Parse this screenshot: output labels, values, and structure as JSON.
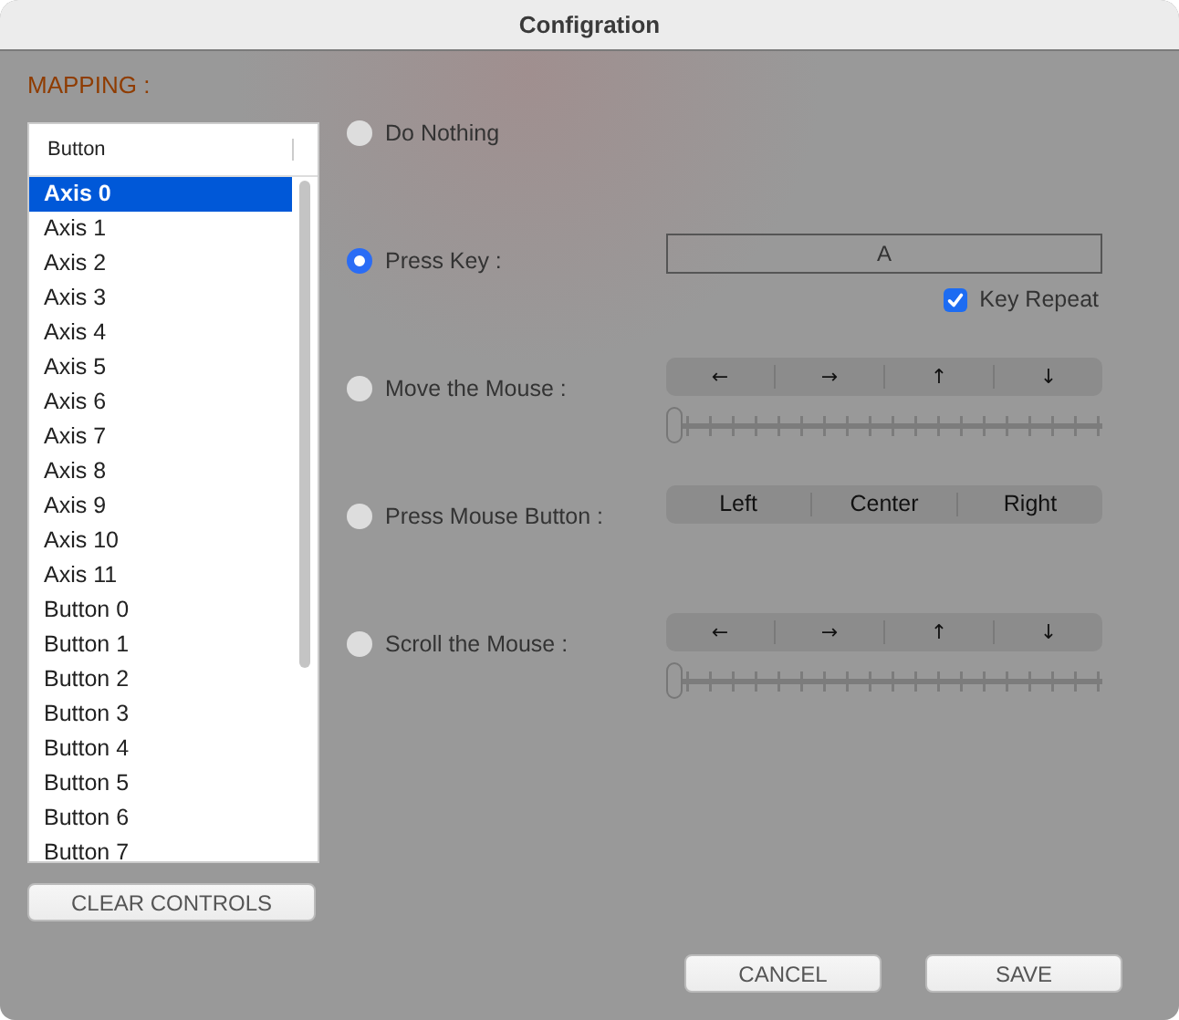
{
  "window": {
    "title": "Configration"
  },
  "mapping_label": "MAPPING :",
  "list": {
    "header": "Button",
    "items": [
      {
        "label": "Axis 0",
        "selected": true
      },
      {
        "label": "Axis 1",
        "selected": false
      },
      {
        "label": "Axis 2",
        "selected": false
      },
      {
        "label": "Axis 3",
        "selected": false
      },
      {
        "label": "Axis 4",
        "selected": false
      },
      {
        "label": "Axis 5",
        "selected": false
      },
      {
        "label": "Axis 6",
        "selected": false
      },
      {
        "label": "Axis 7",
        "selected": false
      },
      {
        "label": "Axis 8",
        "selected": false
      },
      {
        "label": "Axis 9",
        "selected": false
      },
      {
        "label": "Axis 10",
        "selected": false
      },
      {
        "label": "Axis 11",
        "selected": false
      },
      {
        "label": "Button 0",
        "selected": false
      },
      {
        "label": "Button 1",
        "selected": false
      },
      {
        "label": "Button 2",
        "selected": false
      },
      {
        "label": "Button 3",
        "selected": false
      },
      {
        "label": "Button 4",
        "selected": false
      },
      {
        "label": "Button 5",
        "selected": false
      },
      {
        "label": "Button 6",
        "selected": false
      },
      {
        "label": "Button 7",
        "selected": false
      }
    ]
  },
  "clear_button": "CLEAR CONTROLS",
  "options": [
    {
      "kind": "none",
      "label": "Do Nothing",
      "selected": false
    },
    {
      "kind": "key",
      "label": "Press Key :",
      "selected": true,
      "key_value": "A",
      "key_repeat": {
        "label": "Key Repeat",
        "checked": true
      }
    },
    {
      "kind": "arrows",
      "label": "Move the Mouse :",
      "selected": false,
      "arrows": [
        "←",
        "→",
        "↑",
        "↓"
      ],
      "level": 0
    },
    {
      "kind": "segments",
      "label": "Press Mouse Button :",
      "selected": false,
      "segments": [
        "Left",
        "Center",
        "Right"
      ]
    },
    {
      "kind": "arrows",
      "label": "Scroll the Mouse :",
      "selected": false,
      "arrows": [
        "←",
        "→",
        "↑",
        "↓"
      ],
      "level": 0
    }
  ],
  "buttons": [
    "CANCEL",
    "SAVE"
  ]
}
